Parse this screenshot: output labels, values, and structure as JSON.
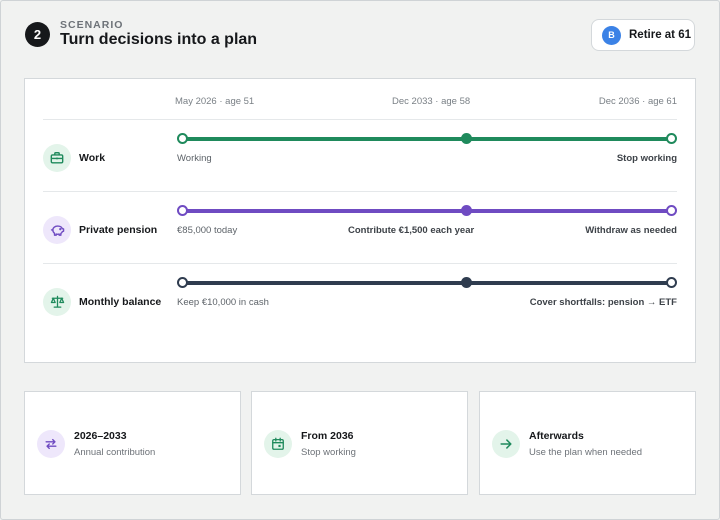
{
  "header": {
    "step": "2",
    "eyebrow": "SCENARIO",
    "title": "Turn decisions into a plan",
    "chip": {
      "avatar": "B",
      "label": "Retire at 61"
    }
  },
  "timeline": {
    "milestones": [
      "May 2026 · age 51",
      "Dec 2033 · age 58",
      "Dec 2036 · age 61"
    ],
    "rows": [
      {
        "name": "Work",
        "icon": "briefcase-icon",
        "color": "#1f8a5c",
        "bg": "#e3f4ea",
        "start": "Working",
        "middle": "",
        "end": "Stop working"
      },
      {
        "name": "Private pension",
        "icon": "piggy-bank-icon",
        "color": "#6f4bc2",
        "bg": "#eee7fb",
        "start": "€85,000 today",
        "middle": "Contribute €1,500 each year",
        "end": "Withdraw as needed"
      },
      {
        "name": "Monthly balance",
        "icon": "scale-icon",
        "color": "#2f3c4f",
        "bg": "#e3f4ea",
        "start": "Keep €10,000 in cash",
        "middle": "",
        "end": "Cover shortfalls: pension → ETF"
      }
    ]
  },
  "cards": [
    {
      "title": "2026–2033",
      "subtitle": "Annual contribution",
      "icon": "repeat-icon",
      "color": "#6f4bc2",
      "bg": "#eee7fb"
    },
    {
      "title": "From 2036",
      "subtitle": "Stop working",
      "icon": "calendar-icon",
      "color": "#1f8a5c",
      "bg": "#e3f4ea"
    },
    {
      "title": "Afterwards",
      "subtitle": "Use the plan when needed",
      "icon": "arrow-right-icon",
      "color": "#1f8a5c",
      "bg": "#e3f4ea"
    }
  ]
}
